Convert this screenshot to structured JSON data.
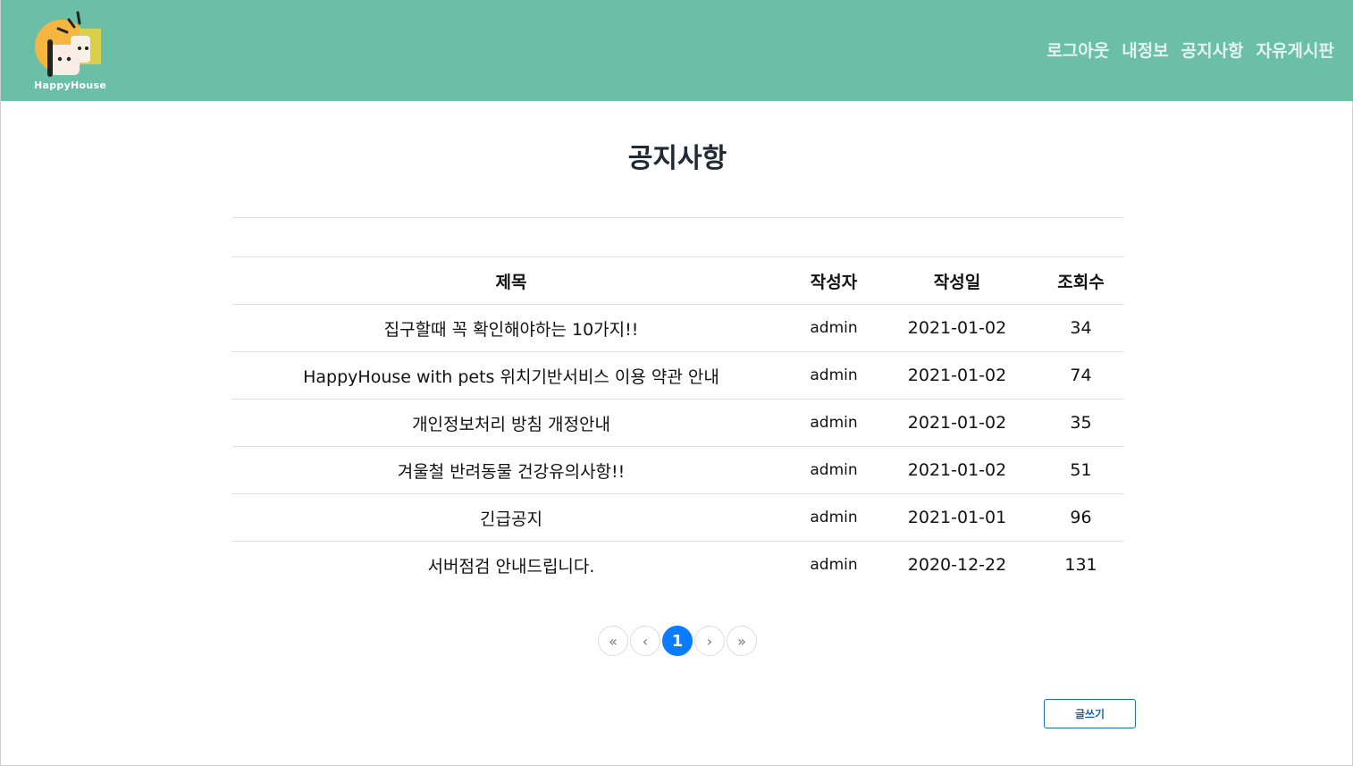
{
  "header": {
    "logo_text": "HappyHouse",
    "nav": [
      {
        "label": "로그아웃"
      },
      {
        "label": "내정보"
      },
      {
        "label": "공지사항"
      },
      {
        "label": "자유게시판"
      }
    ],
    "background_color": "#6bbfa7"
  },
  "page_title": "공지사항",
  "table": {
    "columns": [
      "제목",
      "작성자",
      "작성일",
      "조회수"
    ],
    "rows": [
      {
        "title": "집구할때 꼭 확인해야하는 10가지!!",
        "writer": "admin",
        "date": "2021-01-02",
        "views": "34"
      },
      {
        "title": "HappyHouse with pets 위치기반서비스 이용 약관 안내",
        "writer": "admin",
        "date": "2021-01-02",
        "views": "74"
      },
      {
        "title": "개인정보처리 방침 개정안내",
        "writer": "admin",
        "date": "2021-01-02",
        "views": "35"
      },
      {
        "title": "겨울철 반려동물 건강유의사항!!",
        "writer": "admin",
        "date": "2021-01-02",
        "views": "51"
      },
      {
        "title": "긴급공지",
        "writer": "admin",
        "date": "2021-01-01",
        "views": "96"
      },
      {
        "title": "서버점검 안내드립니다.",
        "writer": "admin",
        "date": "2020-12-22",
        "views": "131"
      }
    ]
  },
  "pagination": {
    "first": "«",
    "prev": "‹",
    "current": "1",
    "next": "›",
    "last": "»",
    "active_color": "#0a7cff"
  },
  "write_button": "글쓰기"
}
